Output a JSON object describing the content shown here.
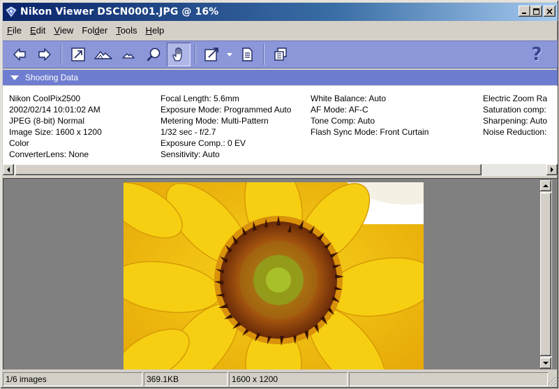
{
  "window": {
    "title": "Nikon Viewer DSCN0001.JPG @ 16%",
    "buttons": {
      "minimize": "_",
      "maximize": "□",
      "close": "✕"
    }
  },
  "menu": [
    {
      "key": "F",
      "rest": "ile"
    },
    {
      "key": "E",
      "rest": "dit"
    },
    {
      "key": "V",
      "rest": "iew"
    },
    {
      "pre": "Fol",
      "key": "d",
      "rest": "er"
    },
    {
      "key": "T",
      "rest": "ools"
    },
    {
      "key": "H",
      "rest": "elp"
    }
  ],
  "toolbar": {
    "icons": [
      "back-arrow-icon",
      "forward-arrow-icon",
      "fit-to-window-icon",
      "zoom-in-mountain-icon",
      "zoom-out-mountain-icon",
      "magnifier-icon",
      "hand-icon",
      "export-icon",
      "dropdown-arrow-icon",
      "print-icon",
      "copy-windows-icon",
      "help-icon"
    ],
    "help_label": "?"
  },
  "shooting_data": {
    "header": "Shooting Data",
    "col1": [
      "Nikon CoolPix2500",
      "2002/02/14 10:01:02 AM",
      "JPEG (8-bit) Normal",
      "Image Size:  1600 x 1200",
      "Color",
      "ConverterLens: None"
    ],
    "col2": [
      "Focal Length: 5.6mm",
      "Exposure Mode: Programmed Auto",
      "Metering Mode: Multi-Pattern",
      "1/32 sec - f/2.7",
      "Exposure Comp.: 0 EV",
      "Sensitivity: Auto"
    ],
    "col3": [
      "White Balance: Auto",
      "AF Mode: AF-C",
      "Tone Comp: Auto",
      "Flash Sync Mode: Front Curtain"
    ],
    "col4": [
      "Electric Zoom Ra",
      "Saturation comp:",
      "Sharpening: Auto",
      "Noise Reduction:"
    ]
  },
  "status": {
    "images": "1/6 images",
    "size": "369.1KB",
    "dimensions": "1600 x 1200",
    "extra": ""
  },
  "colors": {
    "titlebar_start": "#0a246a",
    "titlebar_end": "#a6caf0",
    "toolbar_bg": "#8b97d8",
    "section_header": "#6e7dd0",
    "viewport_bg": "#808080",
    "sunflower_petal": "#f2c40c",
    "sunflower_center": "#b06a10"
  }
}
